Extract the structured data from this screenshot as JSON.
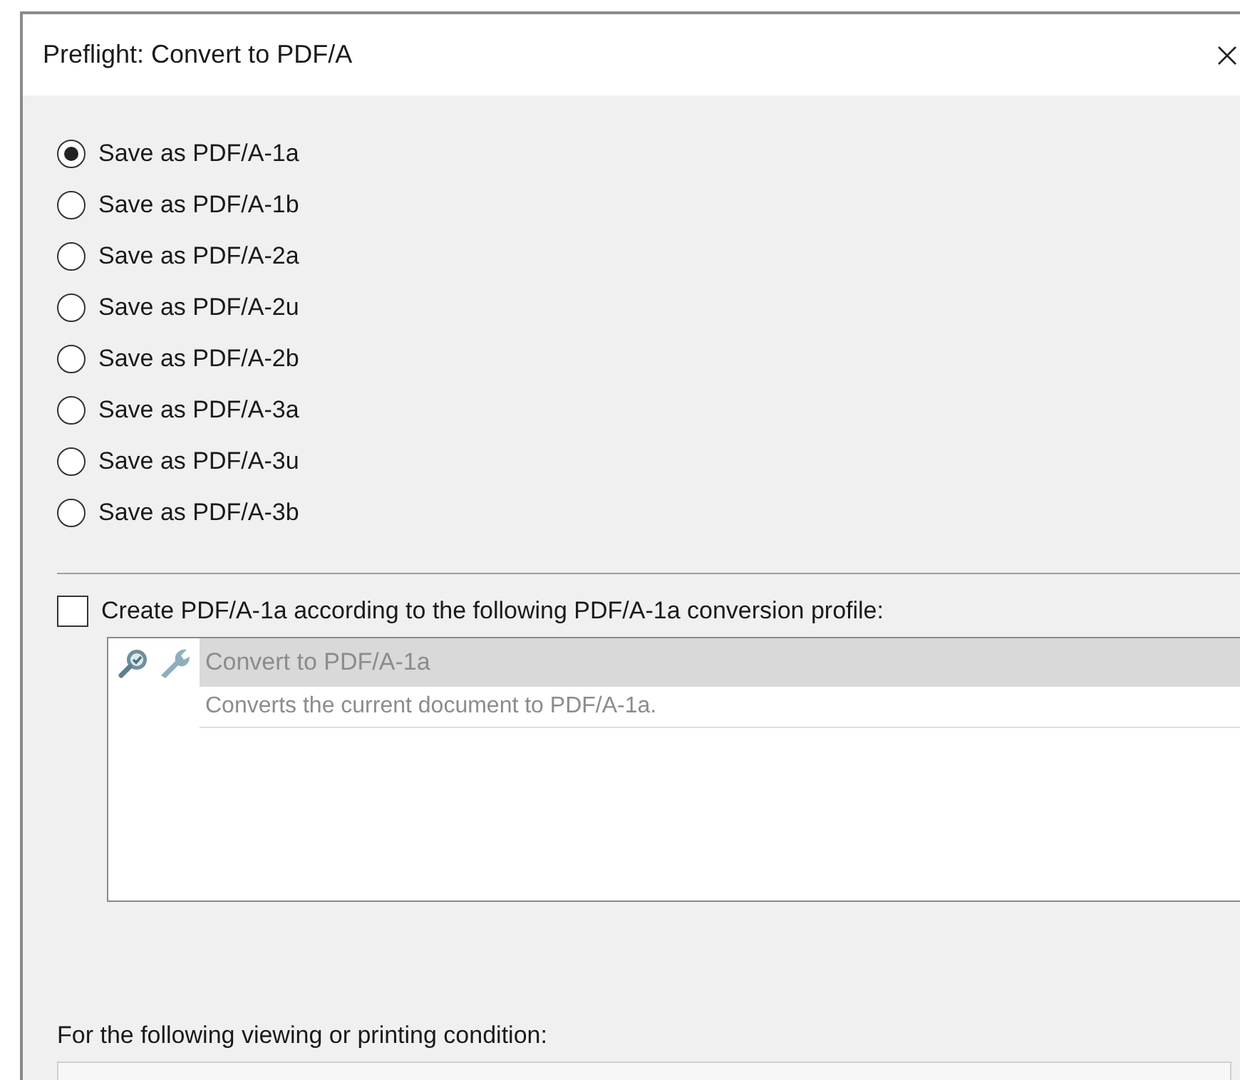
{
  "window": {
    "title": "Preflight: Convert to PDF/A"
  },
  "options": [
    {
      "label": "Save as PDF/A-1a",
      "selected": true
    },
    {
      "label": "Save as PDF/A-1b",
      "selected": false
    },
    {
      "label": "Save as PDF/A-2a",
      "selected": false
    },
    {
      "label": "Save as PDF/A-2u",
      "selected": false
    },
    {
      "label": "Save as PDF/A-2b",
      "selected": false
    },
    {
      "label": "Save as PDF/A-3a",
      "selected": false
    },
    {
      "label": "Save as PDF/A-3u",
      "selected": false
    },
    {
      "label": "Save as PDF/A-3b",
      "selected": false
    }
  ],
  "profile_checkbox": {
    "label": "Create PDF/A-1a according to the following PDF/A-1a conversion profile:",
    "checked": false
  },
  "profile_list": {
    "disabled": true,
    "items": [
      {
        "name": "Convert to PDF/A-1a",
        "description": "Converts the current document to PDF/A-1a.",
        "selected": true
      }
    ]
  },
  "condition": {
    "label": "For the following viewing or printing condition:"
  }
}
